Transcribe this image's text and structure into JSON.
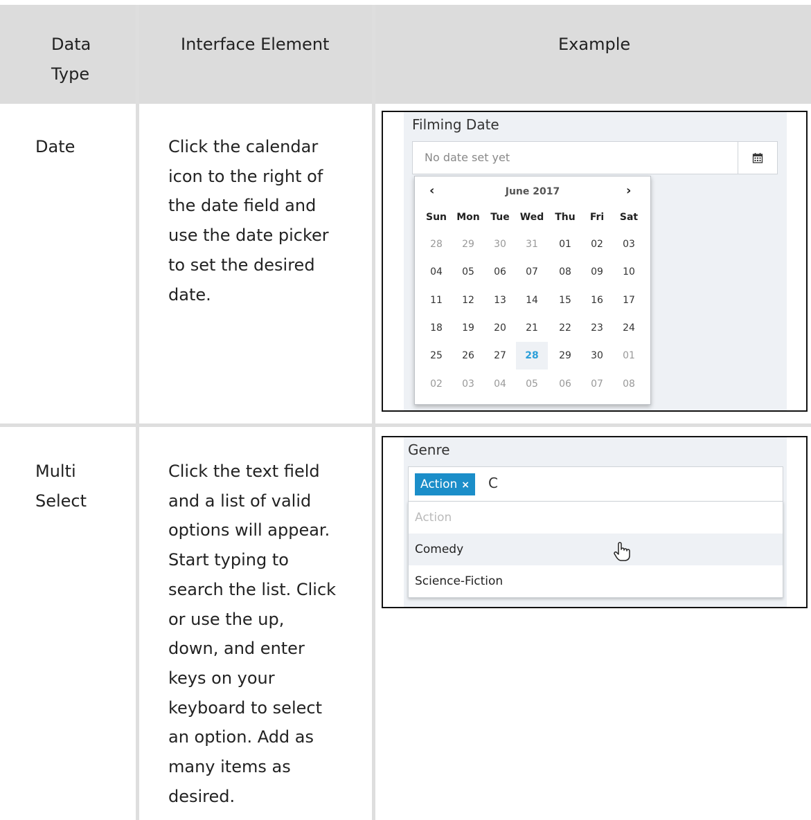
{
  "headers": {
    "data_type_line1": "Data",
    "data_type_line2": "Type",
    "interface_element": "Interface Element",
    "example": "Example"
  },
  "rows": [
    {
      "type_lines": [
        "Date"
      ],
      "description_lines": [
        "Click the calendar",
        "icon to the right of",
        "the date field and",
        "use the date picker",
        "to set the desired",
        "date."
      ],
      "example": {
        "label": "Filming Date",
        "placeholder": "No date set yet",
        "calendar_icon": "calendar-icon",
        "month": "June 2017",
        "prev_icon": "chevron-left-icon",
        "next_icon": "chevron-right-icon",
        "weekdays": [
          "Sun",
          "Mon",
          "Tue",
          "Wed",
          "Thu",
          "Fri",
          "Sat"
        ],
        "weeks": [
          [
            "28",
            "29",
            "30",
            "31",
            "01",
            "02",
            "03"
          ],
          [
            "04",
            "05",
            "06",
            "07",
            "08",
            "09",
            "10"
          ],
          [
            "11",
            "12",
            "13",
            "14",
            "15",
            "16",
            "17"
          ],
          [
            "18",
            "19",
            "20",
            "21",
            "22",
            "23",
            "24"
          ],
          [
            "25",
            "26",
            "27",
            "28",
            "29",
            "30",
            "01"
          ],
          [
            "02",
            "03",
            "04",
            "05",
            "06",
            "07",
            "08"
          ]
        ],
        "selected_day": "28"
      }
    },
    {
      "type_lines": [
        "Multi",
        "Select"
      ],
      "description_lines": [
        "Click the text field",
        "and a list of valid",
        "options will appear.",
        "Start typing to",
        "search the list. Click",
        "or use the up,",
        "down, and enter",
        "keys on your",
        "keyboard to select",
        "an option. Add as",
        "many items as",
        "desired."
      ],
      "example": {
        "label": "Genre",
        "tag": "Action",
        "tag_remove": "×",
        "typed_text": "C",
        "options": [
          "Action",
          "Comedy",
          "Science-Fiction"
        ],
        "cursor_icon": "hand-pointer-icon"
      }
    }
  ],
  "colors": {
    "header_bg": "#dcdcdc",
    "grid": "#dedede",
    "accent": "#1b8ec9",
    "selected_day": "#2b9fd9"
  }
}
